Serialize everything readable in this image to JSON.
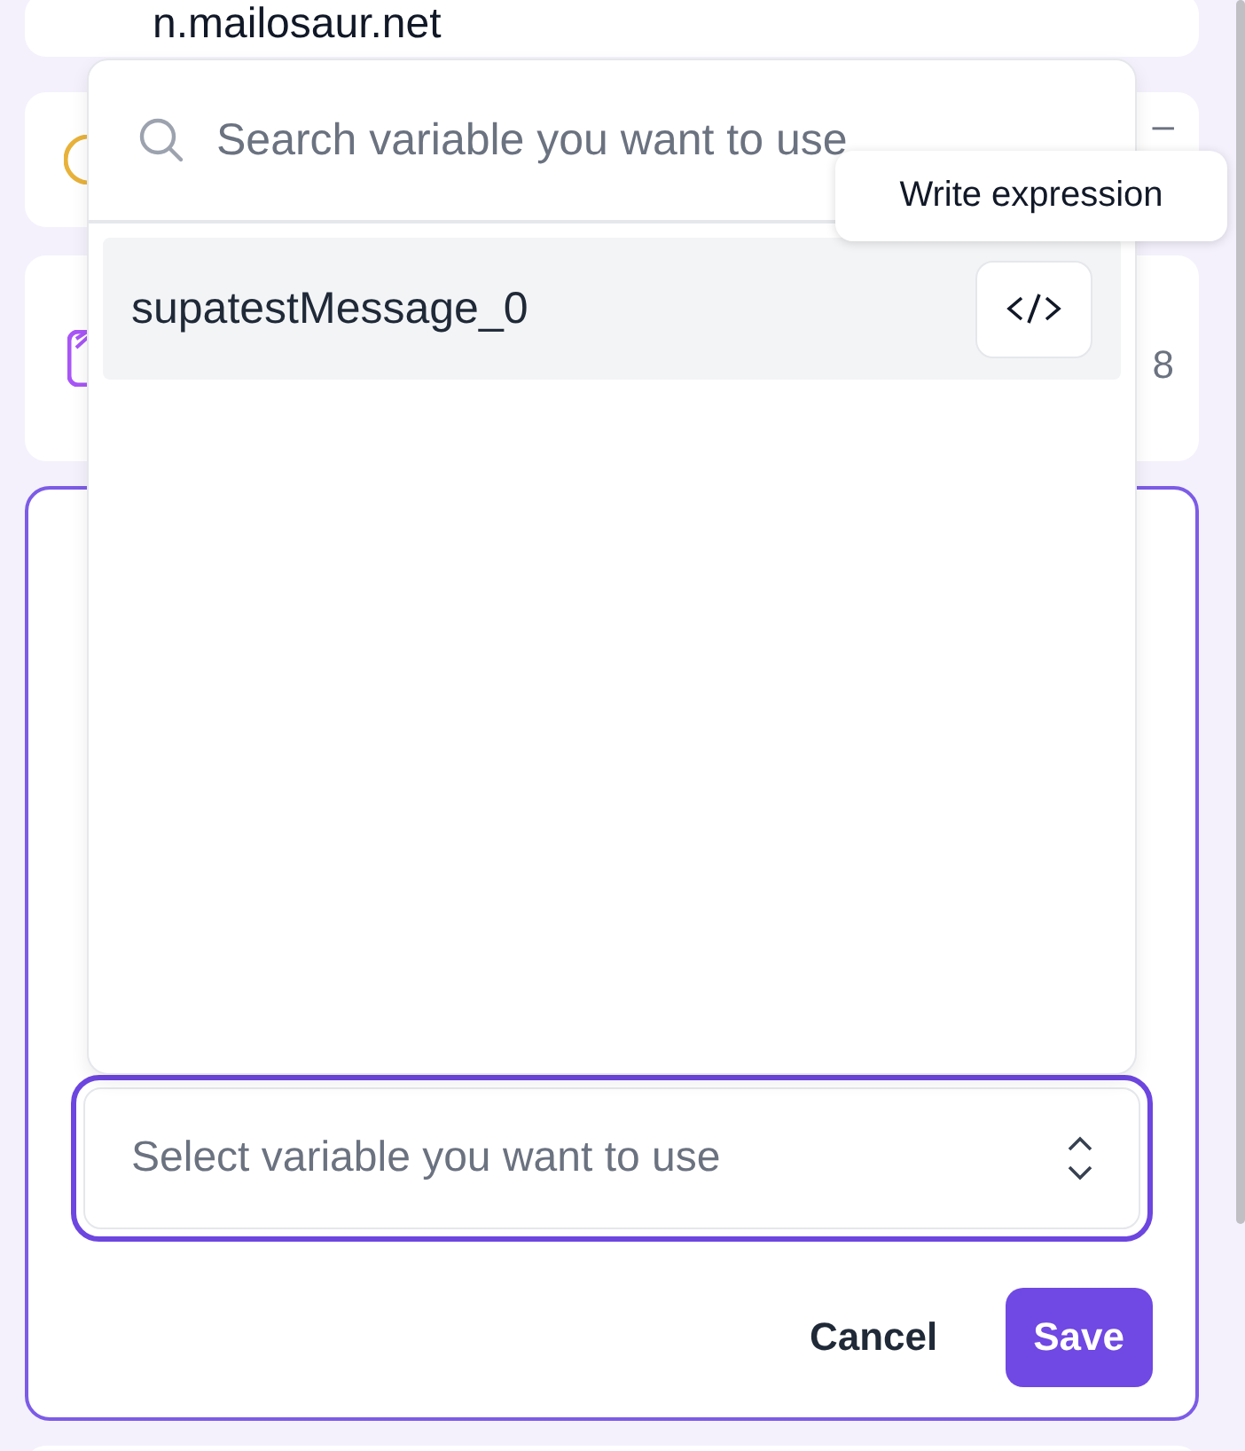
{
  "background_cards": [
    {
      "kind": "text",
      "text": "n.mailosaur.net"
    },
    {
      "kind": "circle",
      "text": "–"
    },
    {
      "kind": "file",
      "text": "8"
    }
  ],
  "variable_picker": {
    "search": {
      "placeholder": "Search variable you want to use"
    },
    "items": [
      {
        "name": "supatestMessage_0",
        "selected": true
      }
    ],
    "tooltip": "Write expression"
  },
  "select": {
    "placeholder": "Select variable you want to use",
    "focused": true
  },
  "buttons": [
    {
      "label": "Cancel",
      "kind": "secondary"
    },
    {
      "label": "Save",
      "kind": "primary"
    }
  ]
}
